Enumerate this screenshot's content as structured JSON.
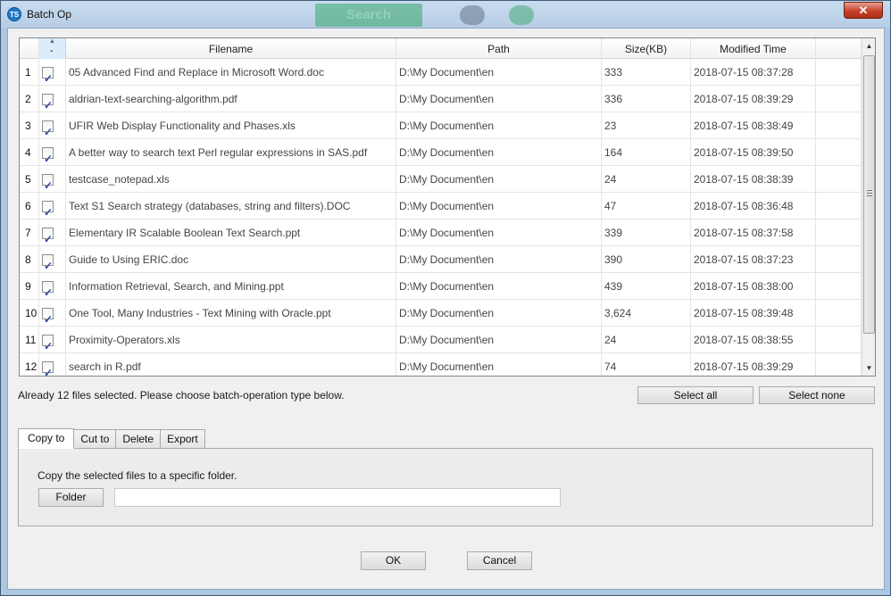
{
  "window": {
    "title": "Batch Op",
    "icon_text": "TS",
    "close_glyph": "✕"
  },
  "background_app": {
    "search_label": "Search"
  },
  "table": {
    "columns": [
      "",
      "Filename",
      "Path",
      "Size(KB)",
      "Modified Time"
    ],
    "check_header": "-",
    "rows": [
      {
        "num": "1",
        "checked": true,
        "filename": "05 Advanced Find and Replace in Microsoft Word.doc",
        "path": "D:\\My Document\\en",
        "size": "333",
        "modified": "2018-07-15 08:37:28"
      },
      {
        "num": "2",
        "checked": true,
        "filename": "aldrian-text-searching-algorithm.pdf",
        "path": "D:\\My Document\\en",
        "size": "336",
        "modified": "2018-07-15 08:39:29"
      },
      {
        "num": "3",
        "checked": true,
        "filename": "UFIR Web Display Functionality and Phases.xls",
        "path": "D:\\My Document\\en",
        "size": "23",
        "modified": "2018-07-15 08:38:49"
      },
      {
        "num": "4",
        "checked": true,
        "filename": "A better way to search text Perl regular expressions in SAS.pdf",
        "path": "D:\\My Document\\en",
        "size": "164",
        "modified": "2018-07-15 08:39:50"
      },
      {
        "num": "5",
        "checked": true,
        "filename": "testcase_notepad.xls",
        "path": "D:\\My Document\\en",
        "size": "24",
        "modified": "2018-07-15 08:38:39"
      },
      {
        "num": "6",
        "checked": true,
        "filename": "Text S1 Search strategy (databases, string and filters).DOC",
        "path": "D:\\My Document\\en",
        "size": "47",
        "modified": "2018-07-15 08:36:48"
      },
      {
        "num": "7",
        "checked": true,
        "filename": "Elementary IR Scalable Boolean Text Search.ppt",
        "path": "D:\\My Document\\en",
        "size": "339",
        "modified": "2018-07-15 08:37:58"
      },
      {
        "num": "8",
        "checked": true,
        "filename": "Guide to Using ERIC.doc",
        "path": "D:\\My Document\\en",
        "size": "390",
        "modified": "2018-07-15 08:37:23"
      },
      {
        "num": "9",
        "checked": true,
        "filename": "Information Retrieval,  Search, and Mining.ppt",
        "path": "D:\\My Document\\en",
        "size": "439",
        "modified": "2018-07-15 08:38:00"
      },
      {
        "num": "10",
        "checked": true,
        "filename": "One Tool, Many Industries - Text Mining with Oracle.ppt",
        "path": "D:\\My Document\\en",
        "size": "3,624",
        "modified": "2018-07-15 08:39:48"
      },
      {
        "num": "11",
        "checked": true,
        "filename": "Proximity-Operators.xls",
        "path": "D:\\My Document\\en",
        "size": "24",
        "modified": "2018-07-15 08:38:55"
      },
      {
        "num": "12",
        "checked": true,
        "filename": "search in R.pdf",
        "path": "D:\\My Document\\en",
        "size": "74",
        "modified": "2018-07-15 08:39:29"
      }
    ]
  },
  "status": {
    "text": "Already 12 files selected. Please choose batch-operation type below."
  },
  "selection": {
    "select_all": "Select all",
    "select_none": "Select none"
  },
  "tabs": [
    {
      "label": "Copy to",
      "active": true
    },
    {
      "label": "Cut to",
      "active": false
    },
    {
      "label": "Delete",
      "active": false
    },
    {
      "label": "Export",
      "active": false
    }
  ],
  "panel": {
    "description": "Copy the selected files to a specific folder.",
    "folder_button": "Folder",
    "folder_value": ""
  },
  "footer": {
    "ok": "OK",
    "cancel": "Cancel"
  },
  "icons": {
    "app": "ts-app-icon",
    "close": "close-icon",
    "scroll_up": "arrow-up-icon",
    "scroll_down": "arrow-down-icon",
    "grip": "grip-icon",
    "sort": "sort-arrow-icon"
  },
  "colors": {
    "title_bg": "#b6cde5",
    "close_red": "#c7412a",
    "dialog_bg": "#f0f0f0",
    "check_color": "#2a4aa0"
  }
}
